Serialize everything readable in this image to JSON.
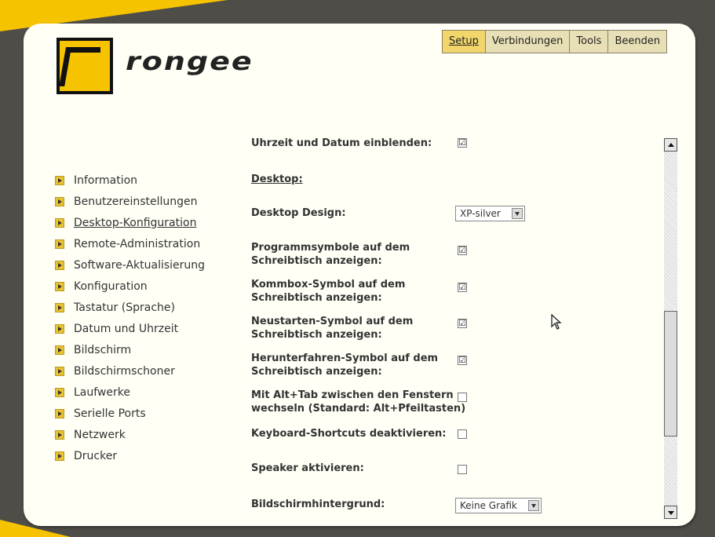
{
  "brand": {
    "logo_text": "rongee"
  },
  "top_menu": [
    {
      "label": "Setup"
    },
    {
      "label": "Verbindungen"
    },
    {
      "label": "Tools"
    },
    {
      "label": "Beenden"
    }
  ],
  "sidebar": {
    "items": [
      {
        "label": "Information"
      },
      {
        "label": "Benutzereinstellungen"
      },
      {
        "label": "Desktop-Konfiguration"
      },
      {
        "label": "Remote-Administration"
      },
      {
        "label": "Software-Aktualisierung"
      },
      {
        "label": "Konfiguration"
      },
      {
        "label": "Tastatur (Sprache)"
      },
      {
        "label": "Datum und Uhrzeit"
      },
      {
        "label": "Bildschirm"
      },
      {
        "label": "Bildschirmschoner"
      },
      {
        "label": "Laufwerke"
      },
      {
        "label": "Serielle Ports"
      },
      {
        "label": "Netzwerk"
      },
      {
        "label": "Drucker"
      }
    ]
  },
  "settings": {
    "clock": {
      "label": "Uhrzeit und Datum einblenden:",
      "checked": "☑"
    },
    "section_desktop": "Desktop:",
    "design": {
      "label": "Desktop Design:",
      "value": "XP-silver"
    },
    "prog_icons": {
      "label1": "Programmsymbole auf dem",
      "label2": "Schreibtisch anzeigen:",
      "checked": "☑"
    },
    "kommbox": {
      "label1": "Kommbox-Symbol auf dem",
      "label2": "Schreibtisch anzeigen:",
      "checked": "☑"
    },
    "restart": {
      "label1": "Neustarten-Symbol auf dem",
      "label2": "Schreibtisch anzeigen:",
      "checked": "☑"
    },
    "shutdown": {
      "label1": "Herunterfahren-Symbol auf dem",
      "label2": "Schreibtisch anzeigen:",
      "checked": "☑"
    },
    "alttab": {
      "label1": "Mit Alt+Tab zwischen den Fenstern",
      "label2": "wechseln (Standard: Alt+Pfeiltasten)",
      "checked": ""
    },
    "shortcuts": {
      "label": "Keyboard-Shortcuts deaktivieren:",
      "checked": ""
    },
    "speaker": {
      "label": "Speaker aktivieren:",
      "checked": ""
    },
    "wallpaper": {
      "label": "Bildschirmhintergrund:",
      "value": "Keine Grafik"
    }
  },
  "colors": {
    "accent": "#f6c300",
    "panel": "#fffff6",
    "frame": "#4f4d48"
  }
}
